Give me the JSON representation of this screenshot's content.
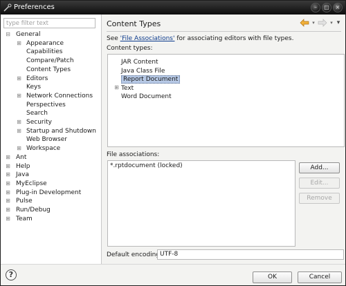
{
  "window": {
    "title": "Preferences"
  },
  "filter": {
    "placeholder": "type filter text"
  },
  "tree": [
    {
      "label": "General",
      "expander": "⊟"
    },
    {
      "label": "Appearance",
      "expander": "⊞"
    },
    {
      "label": "Capabilities",
      "expander": ""
    },
    {
      "label": "Compare/Patch",
      "expander": ""
    },
    {
      "label": "Content Types",
      "expander": ""
    },
    {
      "label": "Editors",
      "expander": "⊞"
    },
    {
      "label": "Keys",
      "expander": ""
    },
    {
      "label": "Network Connections",
      "expander": "⊞"
    },
    {
      "label": "Perspectives",
      "expander": ""
    },
    {
      "label": "Search",
      "expander": ""
    },
    {
      "label": "Security",
      "expander": "⊞"
    },
    {
      "label": "Startup and Shutdown",
      "expander": "⊞"
    },
    {
      "label": "Web Browser",
      "expander": ""
    },
    {
      "label": "Workspace",
      "expander": "⊞"
    },
    {
      "label": "Ant",
      "expander": "⊞"
    },
    {
      "label": "Help",
      "expander": "⊞"
    },
    {
      "label": "Java",
      "expander": "⊞"
    },
    {
      "label": "MyEclipse",
      "expander": "⊞"
    },
    {
      "label": "Plug-in Development",
      "expander": "⊞"
    },
    {
      "label": "Pulse",
      "expander": "⊞"
    },
    {
      "label": "Run/Debug",
      "expander": "⊞"
    },
    {
      "label": "Team",
      "expander": "⊞"
    }
  ],
  "page": {
    "title": "Content Types",
    "desc_prefix": "See ",
    "desc_link": "'File Associations'",
    "desc_suffix": " for associating editors with file types.",
    "content_types_label": "Content types:",
    "content_types": [
      {
        "label": "JAR Content",
        "expander": ""
      },
      {
        "label": "Java Class File",
        "expander": ""
      },
      {
        "label": "Report Document",
        "expander": "",
        "selected": true
      },
      {
        "label": "Text",
        "expander": "⊞"
      },
      {
        "label": "Word Document",
        "expander": ""
      }
    ],
    "file_assoc_label": "File associations:",
    "file_assoc": [
      "*.rptdocument (locked)"
    ],
    "buttons": {
      "add": "Add...",
      "edit": "Edit...",
      "remove": "Remove"
    },
    "encoding_label": "Default encoding:",
    "encoding_value": "UTF-8"
  },
  "footer": {
    "help": "?",
    "ok": "OK",
    "cancel": "Cancel"
  },
  "colors": {
    "title_bar": "#141414",
    "selection": "#b7c9e6",
    "link": "#0b3a8c",
    "nav_arrow": "#e8a020"
  }
}
